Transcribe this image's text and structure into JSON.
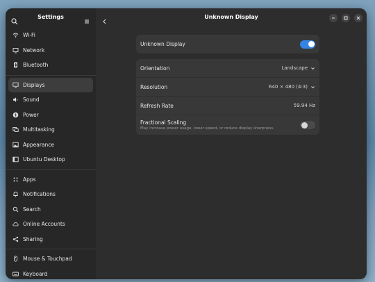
{
  "sidebar": {
    "title": "Settings",
    "groups": [
      [
        {
          "label": "Wi-Fi",
          "icon": "wifi-icon"
        },
        {
          "label": "Network",
          "icon": "network-icon"
        },
        {
          "label": "Bluetooth",
          "icon": "bluetooth-icon"
        }
      ],
      [
        {
          "label": "Displays",
          "icon": "display-icon",
          "active": true
        },
        {
          "label": "Sound",
          "icon": "sound-icon"
        },
        {
          "label": "Power",
          "icon": "power-icon"
        },
        {
          "label": "Multitasking",
          "icon": "multitasking-icon"
        },
        {
          "label": "Appearance",
          "icon": "appearance-icon"
        },
        {
          "label": "Ubuntu Desktop",
          "icon": "ubuntu-desktop-icon"
        }
      ],
      [
        {
          "label": "Apps",
          "icon": "apps-icon"
        },
        {
          "label": "Notifications",
          "icon": "bell-icon"
        },
        {
          "label": "Search",
          "icon": "search-icon"
        },
        {
          "label": "Online Accounts",
          "icon": "cloud-icon"
        },
        {
          "label": "Sharing",
          "icon": "share-icon"
        }
      ],
      [
        {
          "label": "Mouse & Touchpad",
          "icon": "mouse-icon"
        },
        {
          "label": "Keyboard",
          "icon": "keyboard-icon"
        }
      ]
    ]
  },
  "main": {
    "title": "Unknown Display",
    "display_toggle": {
      "label": "Unknown Display",
      "on": true
    },
    "settings": [
      {
        "label": "Orientation",
        "value": "Landscape",
        "dropdown": true
      },
      {
        "label": "Resolution",
        "value": "640 × 480 (4:3)",
        "dropdown": true
      },
      {
        "label": "Refresh Rate",
        "value": "59.94 Hz",
        "dropdown": false
      }
    ],
    "fractional": {
      "label": "Fractional Scaling",
      "subtitle": "May increase power usage, lower speed, or reduce display sharpness.",
      "on": false
    }
  },
  "colors": {
    "accent": "#3584e4",
    "window_bg": "#2d2d2d",
    "sidebar_bg": "#272727",
    "card_bg": "#383838"
  }
}
